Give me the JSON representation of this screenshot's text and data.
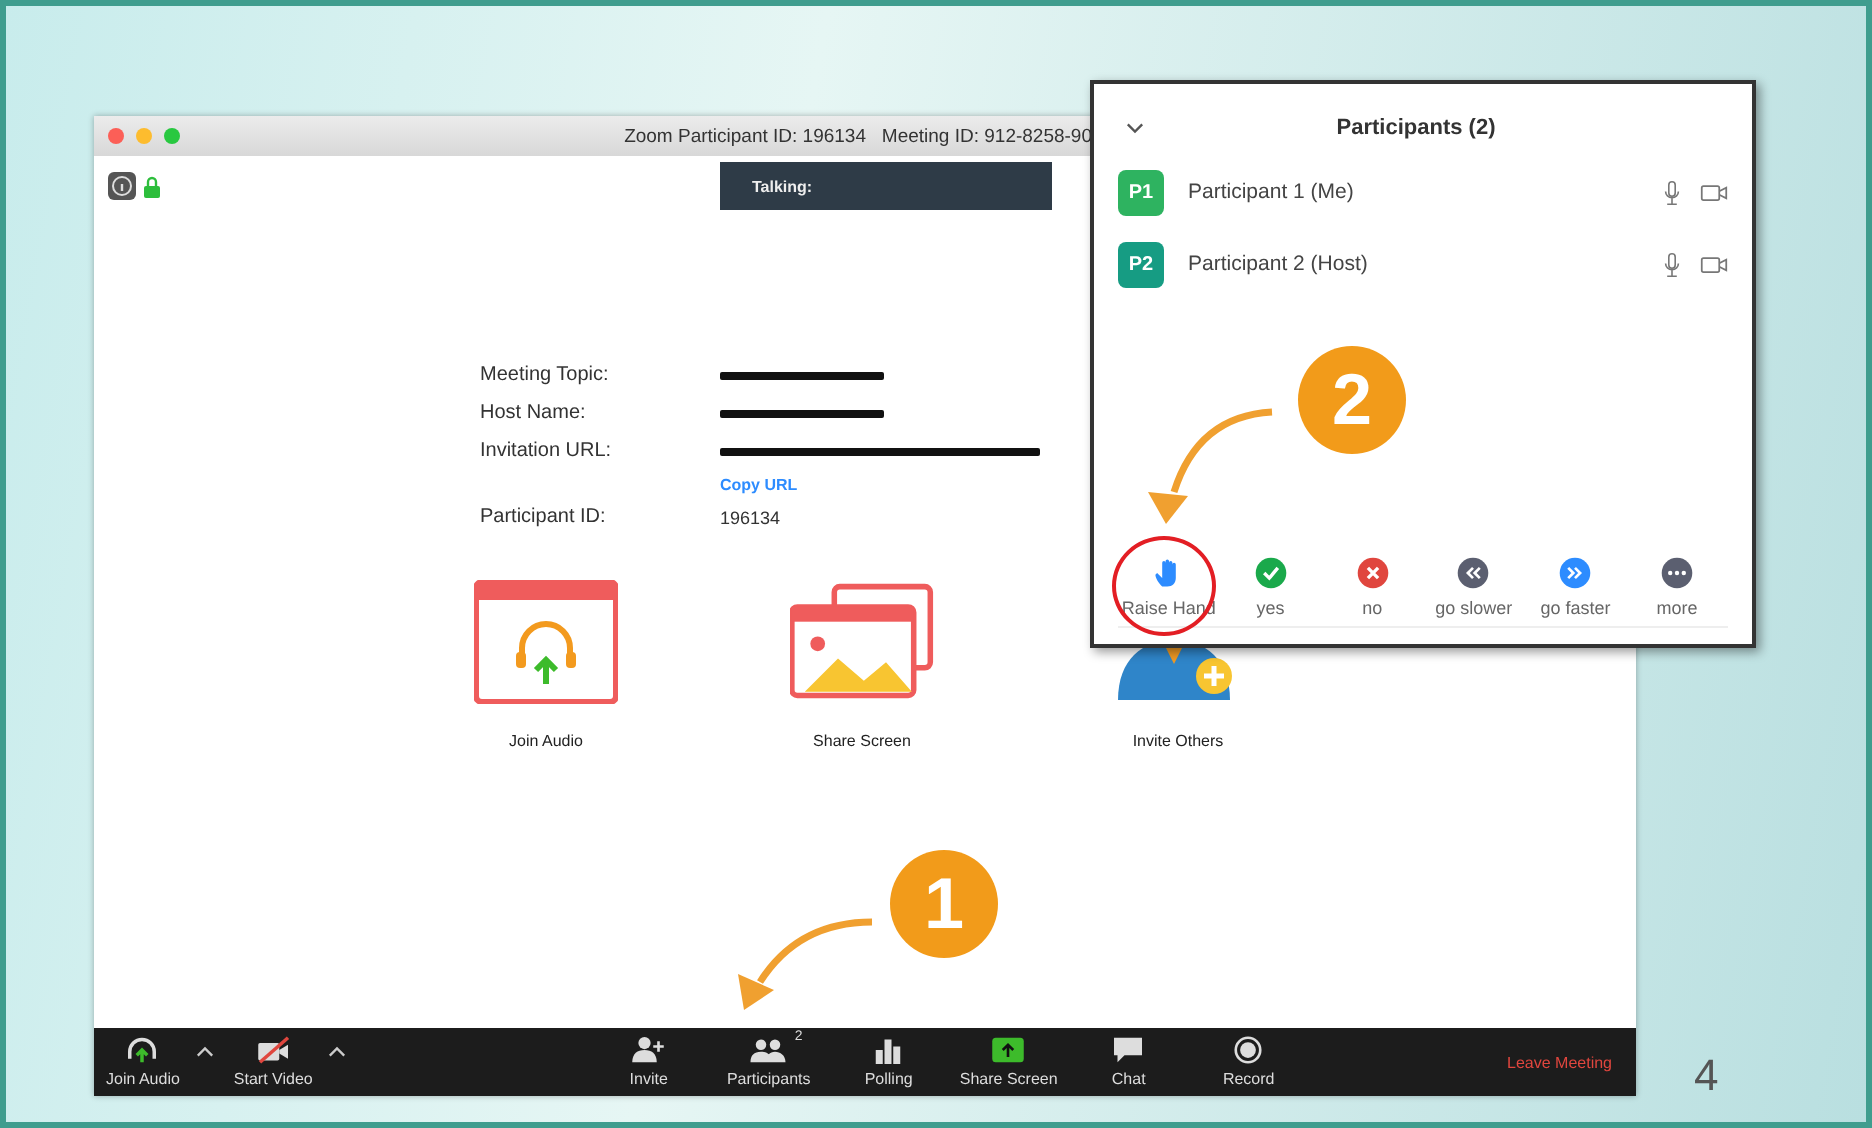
{
  "slide_number": "4",
  "window": {
    "title": "Zoom Participant ID: 196134   Meeting ID: 912-8258-90",
    "talking_label": "Talking:"
  },
  "meeting_info": [
    {
      "kind": "redacted",
      "label": "Meeting Topic:"
    },
    {
      "kind": "redacted",
      "label": "Host Name:"
    },
    {
      "kind": "redacted_long",
      "label": "Invitation URL:"
    },
    {
      "kind": "link",
      "text": "Copy URL"
    },
    {
      "kind": "text",
      "label": "Participant ID:",
      "value": "196134"
    }
  ],
  "actions": [
    {
      "kind": "audio",
      "label": "Join Audio"
    },
    {
      "kind": "share",
      "label": "Share Screen"
    },
    {
      "kind": "invite",
      "label": "Invite Others"
    }
  ],
  "toolbar": {
    "left": [
      {
        "kind": "audio",
        "label": "Join Audio"
      },
      {
        "kind": "video",
        "label": "Start Video"
      }
    ],
    "center": [
      {
        "kind": "invite",
        "label": "Invite"
      },
      {
        "kind": "participants",
        "label": "Participants",
        "badge": "2"
      },
      {
        "kind": "polling",
        "label": "Polling"
      },
      {
        "kind": "share",
        "label": "Share Screen"
      },
      {
        "kind": "chat",
        "label": "Chat"
      },
      {
        "kind": "record",
        "label": "Record"
      }
    ],
    "leave": "Leave Meeting"
  },
  "participants_panel": {
    "title": "Participants (2)",
    "participants": [
      {
        "initials": "P1",
        "name": "Participant 1 (Me)",
        "color": "#2eb360"
      },
      {
        "initials": "P2",
        "name": "Participant 2 (Host)",
        "color": "#169c83"
      }
    ],
    "reactions": [
      {
        "kind": "hand",
        "label": "Raise Hand",
        "color": "#2d8cff"
      },
      {
        "kind": "check",
        "label": "yes",
        "color": "#1aa94b"
      },
      {
        "kind": "cross",
        "label": "no",
        "color": "#e0463e"
      },
      {
        "kind": "slower",
        "label": "go slower",
        "color": "#5b5f70"
      },
      {
        "kind": "faster",
        "label": "go faster",
        "color": "#2d8cff"
      },
      {
        "kind": "more",
        "label": "more",
        "color": "#5b5f70"
      }
    ]
  },
  "callouts": [
    {
      "number": "1"
    },
    {
      "number": "2"
    }
  ]
}
